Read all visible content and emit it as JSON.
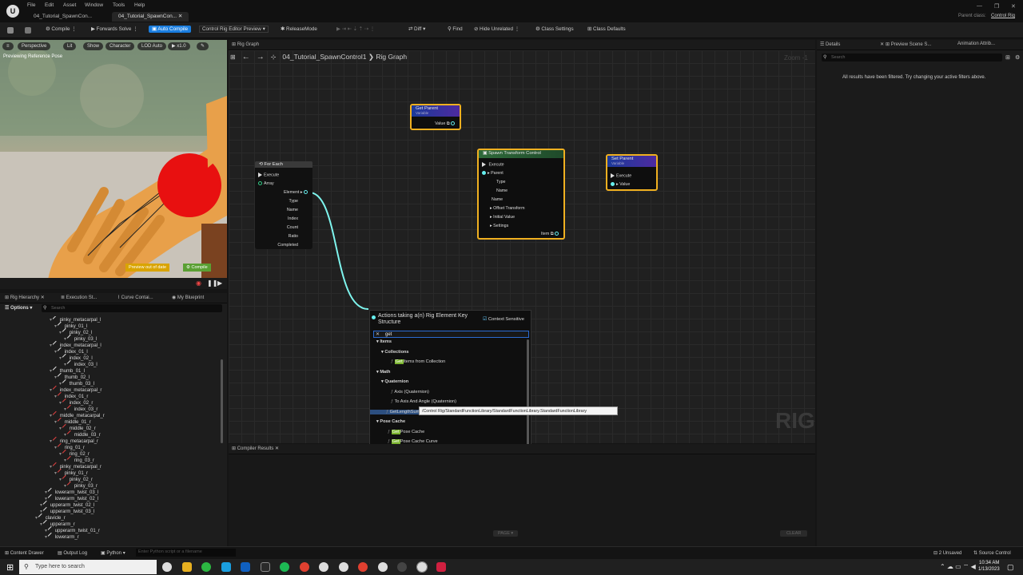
{
  "window": {
    "menu": [
      "File",
      "Edit",
      "Asset",
      "Window",
      "Tools",
      "Help"
    ],
    "doc_tabs": [
      "04_Tutorial_SpawnCon...",
      "04_Tutorial_SpawnCon..."
    ],
    "parent_class_label": "Parent class:",
    "parent_class_value": "Control Rig"
  },
  "toolbar": {
    "compile": "Compile",
    "forwards_solve": "Forwards Solve",
    "auto_compile": "Auto Compile",
    "preview": "Control Rig Editor Preview",
    "release_mode": "ReleaseMode",
    "diff": "Diff",
    "find": "Find",
    "hide_unrelated": "Hide Unrelated",
    "class_settings": "Class Settings",
    "class_defaults": "Class Defaults"
  },
  "viewport": {
    "buttons": [
      "Perspective",
      "Lit",
      "Show",
      "Character",
      "LOD Auto",
      "x1.0"
    ],
    "label": "Previewing Reference Pose",
    "badge_preview": "Preview out of date",
    "badge_compile": "Compile"
  },
  "left_tabs": [
    "Rig Hierarchy",
    "Execution St...",
    "Curve Contai...",
    "My Blueprint"
  ],
  "hierarchy": {
    "options": "Options",
    "search_placeholder": "Search",
    "items": [
      {
        "label": "pinky_metacarpal_l",
        "d": 3,
        "c": "#ddd"
      },
      {
        "label": "pinky_01_l",
        "d": 4,
        "c": "#ddd"
      },
      {
        "label": "pinky_02_l",
        "d": 5,
        "c": "#ddd"
      },
      {
        "label": "pinky_03_l",
        "d": 6,
        "c": "#ddd"
      },
      {
        "label": "index_metacarpal_l",
        "d": 3,
        "c": "#ddd"
      },
      {
        "label": "index_01_l",
        "d": 4,
        "c": "#ddd"
      },
      {
        "label": "index_02_l",
        "d": 5,
        "c": "#ddd"
      },
      {
        "label": "index_03_l",
        "d": 6,
        "c": "#ddd"
      },
      {
        "label": "thumb_01_l",
        "d": 3,
        "c": "#ddd"
      },
      {
        "label": "thumb_02_l",
        "d": 4,
        "c": "#ddd"
      },
      {
        "label": "thumb_03_l",
        "d": 5,
        "c": "#ddd"
      },
      {
        "label": "index_metacarpal_r",
        "d": 3,
        "c": "#e04040"
      },
      {
        "label": "index_01_r",
        "d": 4,
        "c": "#e04040"
      },
      {
        "label": "index_02_r",
        "d": 5,
        "c": "#e04040"
      },
      {
        "label": "index_03_r",
        "d": 6,
        "c": "#e04040"
      },
      {
        "label": "middle_metacarpal_r",
        "d": 3,
        "c": "#e04040"
      },
      {
        "label": "middle_01_r",
        "d": 4,
        "c": "#e04040"
      },
      {
        "label": "middle_02_r",
        "d": 5,
        "c": "#e04040"
      },
      {
        "label": "middle_03_r",
        "d": 6,
        "c": "#e04040"
      },
      {
        "label": "ring_metacarpal_r",
        "d": 3,
        "c": "#e04040"
      },
      {
        "label": "ring_01_r",
        "d": 4,
        "c": "#e04040"
      },
      {
        "label": "ring_02_r",
        "d": 5,
        "c": "#e04040"
      },
      {
        "label": "ring_03_r",
        "d": 6,
        "c": "#e04040"
      },
      {
        "label": "pinky_metacarpal_r",
        "d": 3,
        "c": "#e04040"
      },
      {
        "label": "pinky_01_r",
        "d": 4,
        "c": "#e04040"
      },
      {
        "label": "pinky_02_r",
        "d": 5,
        "c": "#e04040"
      },
      {
        "label": "pinky_03_r",
        "d": 6,
        "c": "#e04040"
      },
      {
        "label": "lowerarm_twist_03_l",
        "d": 2,
        "c": "#ddd"
      },
      {
        "label": "lowerarm_twist_02_l",
        "d": 2,
        "c": "#ddd"
      },
      {
        "label": "upperarm_twist_02_l",
        "d": 1,
        "c": "#ddd"
      },
      {
        "label": "upperarm_twist_03_l",
        "d": 1,
        "c": "#ddd"
      },
      {
        "label": "clavicle_r",
        "d": 0,
        "c": "#ddd"
      },
      {
        "label": "upperarm_r",
        "d": 1,
        "c": "#ddd"
      },
      {
        "label": "upperarm_twist_01_r",
        "d": 2,
        "c": "#ddd"
      },
      {
        "label": "lowerarm_r",
        "d": 2,
        "c": "#ddd"
      }
    ]
  },
  "graph": {
    "tab": "Rig Graph",
    "breadcrumb_asset": "04_Tutorial_SpawnControl1",
    "breadcrumb_graph": "Rig Graph",
    "zoom": "Zoom -1",
    "watermark": "RIG",
    "get_parent": {
      "title": "Get Parent",
      "sub": "Variable",
      "pin": "Value"
    },
    "set_parent": {
      "title": "Set Parent",
      "sub": "Variable",
      "execute": "Execute",
      "value": "Value"
    },
    "for_each": {
      "title": "For Each",
      "pins": [
        "Execute",
        "Array",
        "Element",
        "Type",
        "Name",
        "Index",
        "Count",
        "Ratio",
        "Completed"
      ]
    },
    "spawn": {
      "title": "Spawn Transform Control",
      "pins": [
        "Execute",
        "Parent",
        "Type",
        "Name",
        "Name",
        "Offset Transform",
        "Initial Value",
        "Settings"
      ],
      "out": "Item"
    }
  },
  "popup": {
    "title": "Actions taking a(n) Rig Element Key Structure",
    "context": "Context Sensitive",
    "search": "get",
    "items": [
      {
        "t": "Items",
        "k": "cat",
        "x": 8
      },
      {
        "t": "Collections",
        "k": "cat",
        "x": 14
      },
      {
        "h": "Get",
        "t": "Items from Collection",
        "x": 26
      },
      {
        "t": "Math",
        "k": "cat",
        "x": 8
      },
      {
        "t": "Quaternion",
        "k": "cat",
        "x": 14
      },
      {
        "t": "Axis (Quaternion)",
        "x": 26
      },
      {
        "t": "To Axis And Angle (Quaternion)",
        "x": 26
      },
      {
        "t": "GetLengthSum",
        "x": 20,
        "sel": true
      },
      {
        "t": "Pose Cache",
        "k": "cat",
        "x": 8
      },
      {
        "h": "Get",
        "t": "Pose Cache",
        "x": 22
      },
      {
        "h": "Get",
        "t": "Pose Cache Curve",
        "x": 22
      },
      {
        "h": "Get",
        "t": "Pose Cache Delta",
        "x": 22
      },
      {
        "h": "Get",
        "t": "Pose Cache Items",
        "x": 22
      },
      {
        "h": "Get",
        "t": "Pose Cache Transform",
        "x": 22
      },
      {
        "h": "Get",
        "t": "Pose Cache Transform Array",
        "x": 22
      }
    ],
    "tooltip": "/Control Rig/StandardFunctionLibrary/StandardFunctionLibrary.StandardFunctionLibrary"
  },
  "compiler": {
    "tab": "Compiler Results",
    "page": "PAGE",
    "clear": "CLEAR"
  },
  "details": {
    "tabs": [
      "Details",
      "Preview Scene S...",
      "Animation Attrib..."
    ],
    "search_placeholder": "Search",
    "message": "All results have been filtered. Try changing your active filters above."
  },
  "bottombar": {
    "content_drawer": "Content Drawer",
    "output_log": "Output Log",
    "python": "Python",
    "cmd_placeholder": "Enter Python script or a filename",
    "unsaved": "2 Unsaved",
    "source_control": "Source Control"
  },
  "taskbar": {
    "search": "Type here to search",
    "time": "10:34 AM",
    "date": "1/13/2023"
  }
}
